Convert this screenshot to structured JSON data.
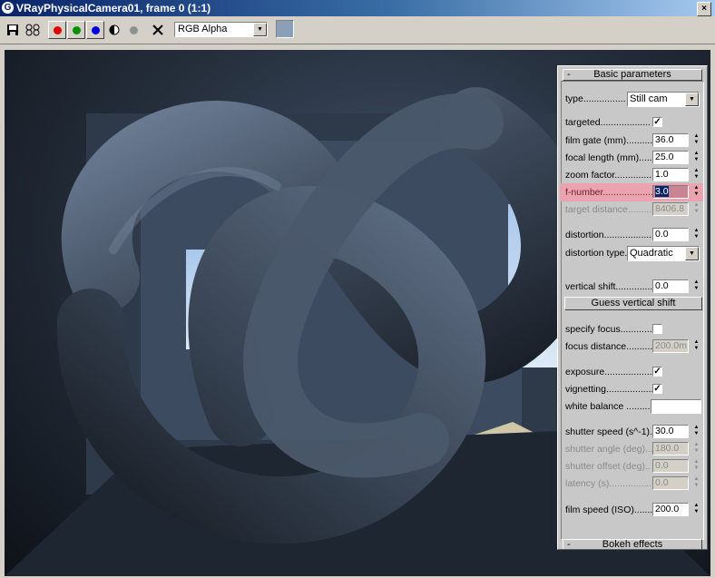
{
  "window": {
    "title": "VRayPhysicalCamera01, frame 0 (1:1)"
  },
  "toolbar": {
    "channel_value": "RGB Alpha"
  },
  "panel": {
    "basic_title": "Basic parameters",
    "bokeh_title": "Bokeh effects",
    "collapse_symbol": "-",
    "type_label": "type................",
    "type_value": "Still cam",
    "targeted_label": "targeted...................",
    "film_gate_label": "film gate (mm)............",
    "film_gate_value": "36.0",
    "focal_length_label": "focal length (mm).........",
    "focal_length_value": "25.0",
    "zoom_factor_label": "zoom factor..............",
    "zoom_factor_value": "1.0",
    "f_number_label": "f-number...................",
    "f_number_value": "3.0",
    "target_distance_label": "target distance...........",
    "target_distance_value": "8406.8",
    "distortion_label": "distortion..................",
    "distortion_value": "0.0",
    "distortion_type_label": "distortion type.",
    "distortion_type_value": "Quadratic",
    "vertical_shift_label": "vertical shift...............",
    "vertical_shift_value": "0.0",
    "guess_vertical_shift": "Guess vertical shift",
    "specify_focus_label": "specify focus..............",
    "focus_distance_label": "focus distance.............",
    "focus_distance_value": "200.0m",
    "exposure_label": "exposure.....................",
    "vignetting_label": "vignetting...................",
    "white_balance_label": "white balance .........",
    "shutter_speed_label": "shutter speed (s^-1).",
    "shutter_speed_value": "30.0",
    "shutter_angle_label": "shutter angle (deg)...",
    "shutter_angle_value": "180.0",
    "shutter_offset_label": "shutter offset (deg)..",
    "shutter_offset_value": "0.0",
    "latency_label": "latency (s)..................",
    "latency_value": "0.0",
    "film_speed_label": "film speed (ISO).......",
    "film_speed_value": "200.0",
    "check_mark": "✓"
  }
}
